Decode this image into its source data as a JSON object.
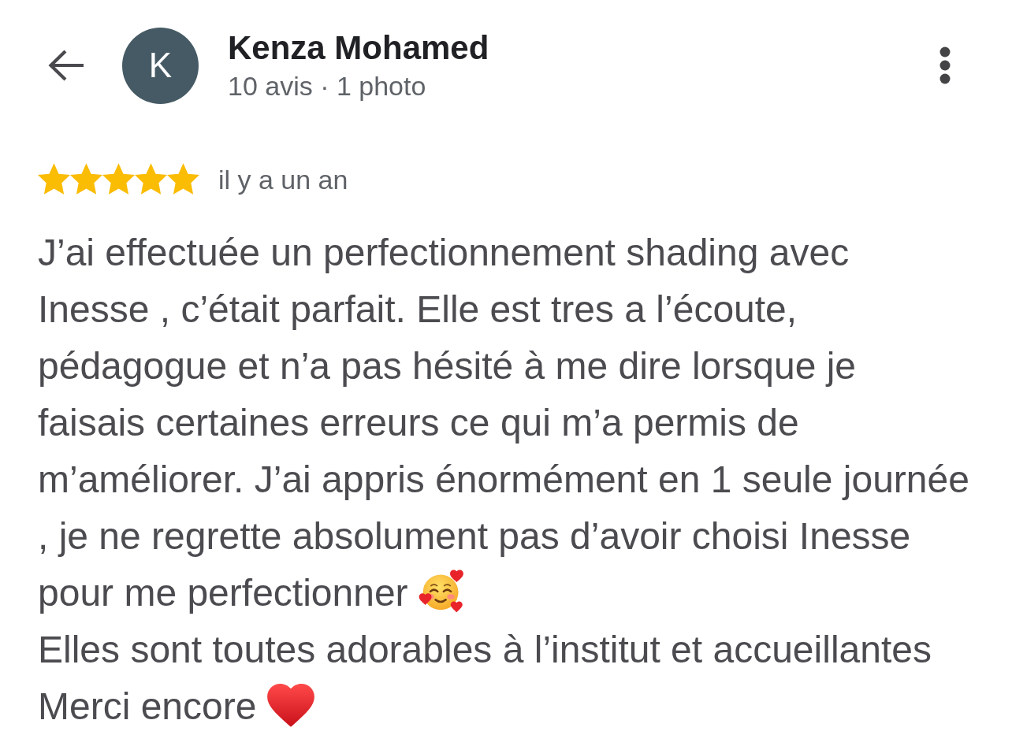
{
  "header": {
    "avatar_letter": "K",
    "name": "Kenza Mohamed",
    "stats": "10 avis · 1 photo"
  },
  "rating": {
    "stars": 5,
    "time": "il y a un an"
  },
  "review": {
    "paragraphs": [
      {
        "kind": "smiley",
        "lines": [
          "J’ai effectuée un perfectionnement shading avec",
          "Inesse , c’était parfait. Elle est tres a l’écoute,",
          "pédagogue et n’a pas hésité à me dire lorsque je",
          "faisais certaines erreurs ce qui m’a permis de",
          "m’améliorer. J’ai appris énormément en 1 seule journée",
          ", je ne regrette absolument pas d’avoir choisi Inesse",
          "pour me perfectionner"
        ]
      },
      {
        "kind": "plain",
        "lines": [
          "Elles sont toutes adorables à l’institut et accueillantes"
        ]
      },
      {
        "kind": "heart",
        "lines": [
          "Merci encore"
        ]
      }
    ]
  }
}
